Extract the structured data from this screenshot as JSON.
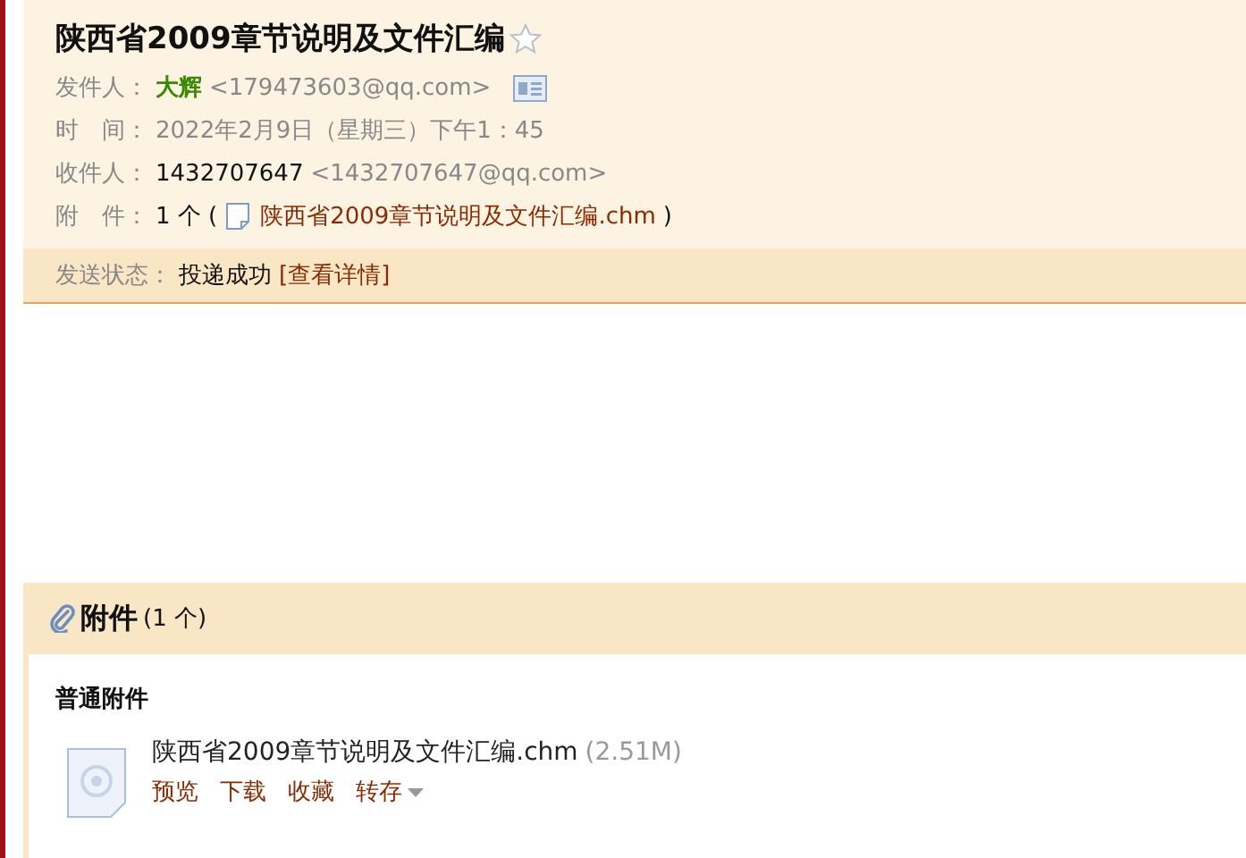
{
  "header": {
    "title": "陕西省2009章节说明及文件汇编",
    "starred": false,
    "sender": {
      "label": "发件人：",
      "name": "大辉",
      "address": "<179473603@qq.com>"
    },
    "time": {
      "label": "时　间：",
      "value": "2022年2月9日（星期三）下午1：45"
    },
    "recipient": {
      "label": "收件人：",
      "name": "1432707647",
      "address": "<1432707647@qq.com>"
    },
    "attachment": {
      "label": "附　件：",
      "prefix": "1 个 (",
      "file": "陕西省2009章节说明及文件汇编.chm",
      "suffix": ")"
    }
  },
  "status": {
    "label": "发送状态：",
    "value": "投递成功",
    "link": "[查看详情]"
  },
  "attachments": {
    "title": "附件",
    "count": "(1 个)",
    "section": "普通附件",
    "files": [
      {
        "name": "陕西省2009章节说明及文件汇编.chm",
        "size": "(2.51M)",
        "actions": [
          {
            "label": "预览",
            "kind": "link"
          },
          {
            "label": "下载",
            "kind": "link"
          },
          {
            "label": "收藏",
            "kind": "link"
          },
          {
            "label": "转存",
            "kind": "menu"
          }
        ]
      }
    ]
  }
}
